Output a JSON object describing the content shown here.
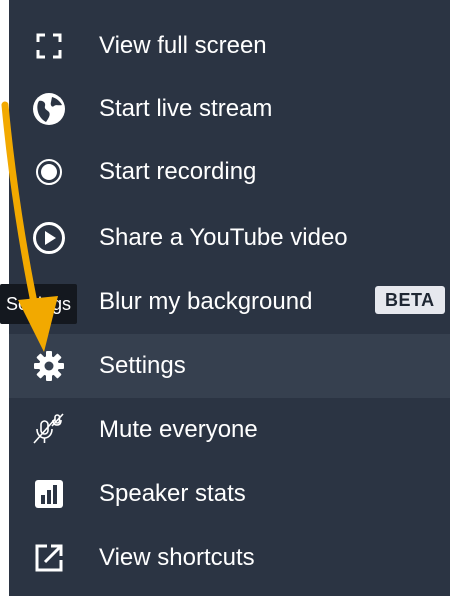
{
  "menu": {
    "items": [
      {
        "label": "View full screen",
        "icon": "fullscreen-icon"
      },
      {
        "label": "Start live stream",
        "icon": "live-stream-icon"
      },
      {
        "label": "Start recording",
        "icon": "record-icon"
      },
      {
        "label": "Share a YouTube video",
        "icon": "play-circle-icon"
      },
      {
        "label": "Blur my background",
        "icon": "blur-icon",
        "badge": "BETA"
      },
      {
        "label": "Settings",
        "icon": "gear-icon",
        "active": true
      },
      {
        "label": "Mute everyone",
        "icon": "mute-everyone-icon"
      },
      {
        "label": "Speaker stats",
        "icon": "stats-icon"
      },
      {
        "label": "View shortcuts",
        "icon": "shortcuts-icon"
      }
    ]
  },
  "tooltip": {
    "text": "Settings"
  },
  "colors": {
    "menu_background": "#2b3443",
    "active_background": "#36404f",
    "arrow": "#f2a900",
    "badge_background": "#e6e8ee"
  }
}
